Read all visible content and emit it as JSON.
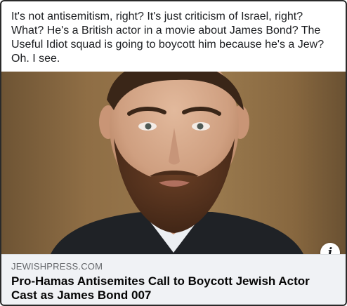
{
  "post": {
    "text": "It's not antisemitism, right? It's just criticism of Israel, right?\nWhat? He's a British actor in a movie about James Bond? The\nUseful Idiot squad is going to boycott him because he's a Jew?\nOh. I see."
  },
  "link_preview": {
    "domain": "JEWISHPRESS.COM",
    "headline": "Pro-Hamas Antisemites Call to Boycott Jewish Actor\nCast as James Bond 007",
    "info_icon": "info-icon",
    "info_glyph": "i"
  },
  "colors": {
    "caption_bg": "#f0f2f5",
    "domain_text": "#65676b",
    "headline_text": "#050505",
    "photo_bg": "#8d6c44"
  }
}
